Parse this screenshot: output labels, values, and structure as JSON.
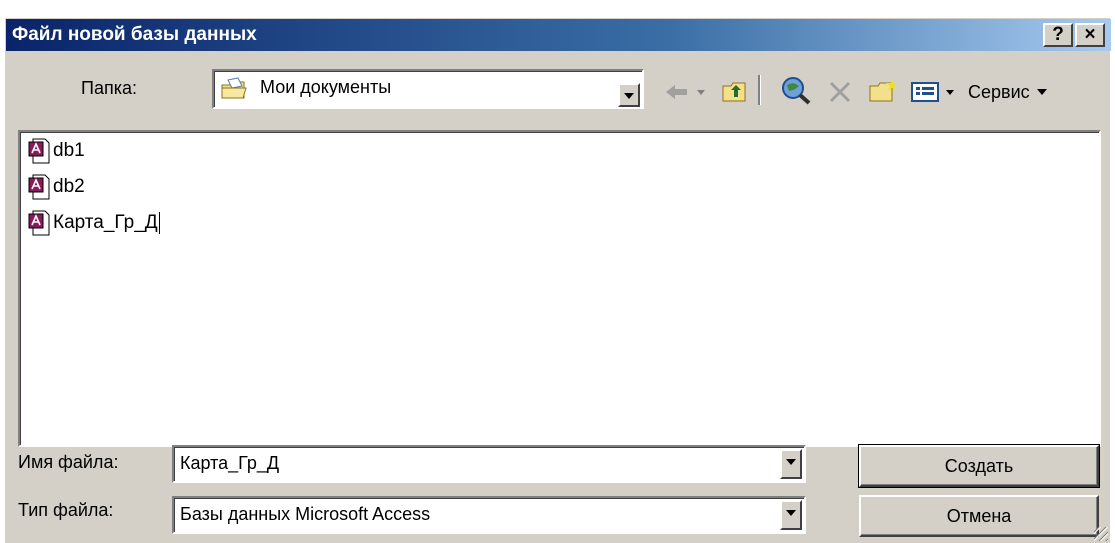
{
  "window": {
    "title": "Файл новой базы данных",
    "help_glyph": "?",
    "close_glyph": "×"
  },
  "toolbar": {
    "folder_label": "Папка:",
    "folder_value": "Мои документы",
    "tools_label": "Сервис"
  },
  "files": [
    {
      "name": "db1"
    },
    {
      "name": "db2"
    },
    {
      "name": "Карта_Гр_Д"
    }
  ],
  "form": {
    "filename_label": "Имя файла:",
    "filename_value": "Карта_Гр_Д",
    "filetype_label": "Тип файла:",
    "filetype_value": "Базы данных Microsoft Access"
  },
  "buttons": {
    "create_pre": "Соз",
    "create_accel": "д",
    "create_post": "ать",
    "cancel": "Отмена"
  },
  "colors": {
    "title_gradient_start": "#0a246a",
    "title_gradient_end": "#a6caf0",
    "face": "#d4d0c8",
    "access_icon": "#8b1a5a"
  }
}
